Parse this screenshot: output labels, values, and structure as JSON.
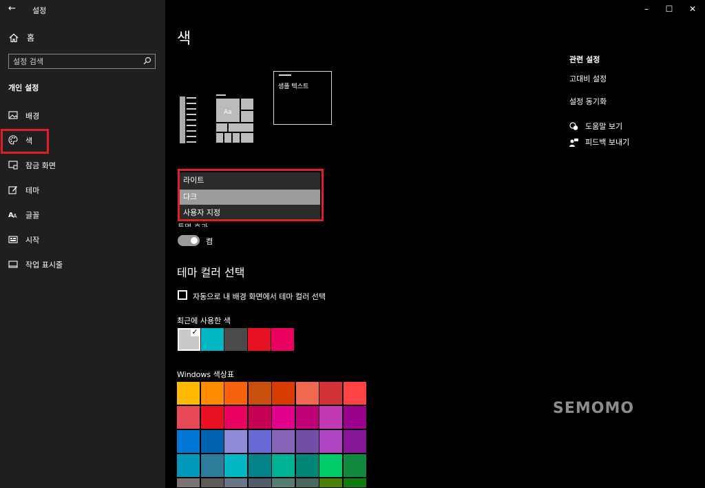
{
  "window": {
    "app_title": "설정",
    "back_glyph": "←",
    "minimize_glyph": "–",
    "maximize_glyph": "☐",
    "close_glyph": "✕"
  },
  "sidebar": {
    "home_label": "홈",
    "search_placeholder": "설정 검색",
    "section_title": "개인 설정",
    "items": [
      {
        "label": "배경",
        "icon": "image-icon"
      },
      {
        "label": "색",
        "icon": "palette-icon",
        "selected": true
      },
      {
        "label": "잠금 화면",
        "icon": "lock-screen-icon"
      },
      {
        "label": "테마",
        "icon": "theme-icon"
      },
      {
        "label": "글꼴",
        "icon": "font-icon"
      },
      {
        "label": "시작",
        "icon": "start-icon"
      },
      {
        "label": "작업 표시줄",
        "icon": "taskbar-icon"
      }
    ]
  },
  "main": {
    "title": "색",
    "sample_text": "샘플 텍스트",
    "mode_dropdown": {
      "options": [
        "라이트",
        "다크",
        "사용자 지정"
      ],
      "selected": "다크"
    },
    "transparency_label_cut": "투명 효과",
    "toggle_state": "켬",
    "theme_color_title": "테마 컬러 선택",
    "auto_color_label": "자동으로 내 배경 화면에서 테마 컬러 선택",
    "recent_colors_title": "최근에 사용한 색",
    "recent_colors": [
      "#c9c9c9",
      "#00b7c3",
      "#4c4a48",
      "#e81123",
      "#ea005e"
    ],
    "windows_colors_title": "Windows 색상표",
    "windows_colors": [
      [
        "#ffb900",
        "#ff8c00",
        "#f7630c",
        "#ca5010",
        "#da3b01",
        "#ef6950",
        "#d13438",
        "#ff4343"
      ],
      [
        "#e74856",
        "#e81123",
        "#ea005e",
        "#c30052",
        "#e3008c",
        "#bf0077",
        "#c239b3",
        "#9a0089"
      ],
      [
        "#0078d7",
        "#0063b1",
        "#8e8cd8",
        "#6b69d6",
        "#8764b8",
        "#744da9",
        "#b146c2",
        "#881798"
      ],
      [
        "#0099bc",
        "#2d7d9a",
        "#00b7c3",
        "#038387",
        "#00b294",
        "#018574",
        "#00cc6a",
        "#10893e"
      ],
      [
        "#7a7574",
        "#5d5a58",
        "#68768a",
        "#515c6b",
        "#567c73",
        "#486860",
        "#498205",
        "#107c10"
      ]
    ]
  },
  "related": {
    "title": "관련 설정",
    "links": [
      "고대비 설정",
      "설정 동기화"
    ],
    "help_label": "도움말 보기",
    "feedback_label": "피드백 보내기"
  },
  "watermark": "SEMOMO",
  "colors": {
    "highlight_border": "#e01e26",
    "sidebar_bg": "#1f1f1f",
    "main_bg": "#000000"
  }
}
